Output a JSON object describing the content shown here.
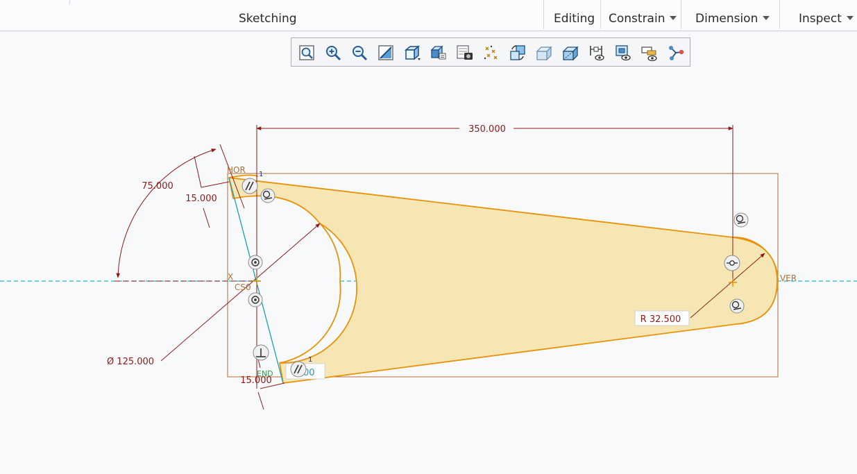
{
  "ribbon": {
    "group_label": "Sketching",
    "tabs": [
      {
        "label": "Editing",
        "dropdown": false
      },
      {
        "label": "Constrain",
        "dropdown": true
      },
      {
        "label": "Dimension",
        "dropdown": true
      },
      {
        "label": "Inspect",
        "dropdown": true
      }
    ]
  },
  "toolbar": {
    "tools": [
      "refit-icon",
      "zoom-in-icon",
      "zoom-out-icon",
      "repaint-icon",
      "saved-orientations-icon",
      "view-manager-icon",
      "display-style-icon",
      "datum-display-icon",
      "spin-center-icon",
      "sketch-view-icon",
      "perspective-icon",
      "annotation-display-icon",
      "sketcher-display-icon",
      "appearance-icon",
      "references-icon"
    ]
  },
  "sketch": {
    "dimensions": {
      "length": "350.000",
      "angle": "75.000",
      "width_top": "15.000",
      "width_bottom": "15.000",
      "diameter": "Ø 125.000",
      "radius": "R 32.500",
      "partial_value": "00"
    },
    "references": {
      "hor": "HOR",
      "ver": "VER",
      "x_axis": "X",
      "csys": "CS0",
      "end": "END"
    },
    "constraint_tags": {
      "top_index": "1",
      "bottom_index": "1"
    },
    "colors": {
      "profile": "#e8920a",
      "fill": "#f5e6b3",
      "dimension": "#8b1a1a",
      "reference": "#b07030",
      "centerline": "#2ab6c4",
      "construction": "#1e9cb8"
    }
  }
}
